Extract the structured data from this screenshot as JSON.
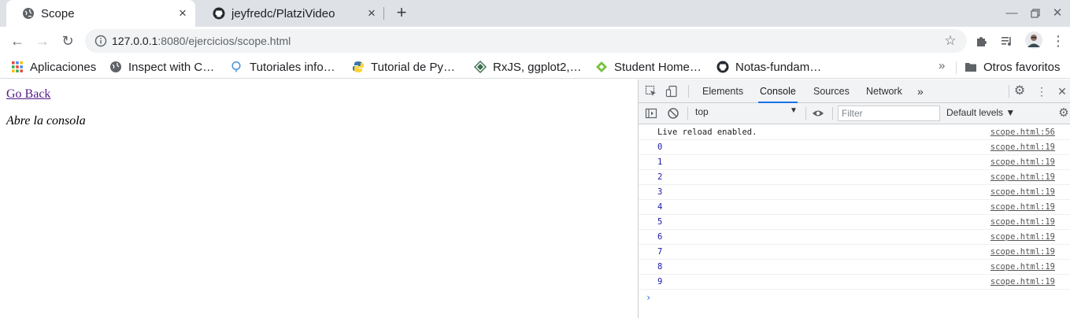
{
  "browser": {
    "tabs": [
      {
        "title": "Scope",
        "icon": "globe-icon",
        "active": true
      },
      {
        "title": "jeyfredc/PlatziVideo",
        "icon": "github-icon",
        "active": false
      }
    ],
    "new_tab": "+",
    "close_glyph": "×",
    "url": {
      "host": "127.0.0.1",
      "rest": ":8080/ejercicios/scope.html"
    },
    "bookmarks": [
      {
        "label": "Aplicaciones",
        "icon": "apps-grid-icon"
      },
      {
        "label": "Inspect with C…",
        "icon": "globe-icon"
      },
      {
        "label": "Tutoriales info…",
        "icon": "search-bulb-icon"
      },
      {
        "label": "Tutorial de Py…",
        "icon": "python-icon"
      },
      {
        "label": "RxJS, ggplot2,…",
        "icon": "diamond-icon"
      },
      {
        "label": "Student Home…",
        "icon": "green-diamond-icon"
      },
      {
        "label": "Notas-fundam…",
        "icon": "github-icon"
      }
    ],
    "bookmarks_overflow": "»",
    "other_bookmarks": "Otros favoritos"
  },
  "page": {
    "back_link": "Go Back",
    "instruction": "Abre la consola"
  },
  "devtools": {
    "tabs": [
      "Elements",
      "Console",
      "Sources",
      "Network"
    ],
    "active_tab": "Console",
    "more_tabs": "»",
    "context": "top",
    "filter_placeholder": "Filter",
    "levels": "Default levels ▼",
    "logs": [
      {
        "msg": "Live reload enabled.",
        "src": "scope.html:56",
        "kind": "text"
      },
      {
        "msg": "0",
        "src": "scope.html:19",
        "kind": "num"
      },
      {
        "msg": "1",
        "src": "scope.html:19",
        "kind": "num"
      },
      {
        "msg": "2",
        "src": "scope.html:19",
        "kind": "num"
      },
      {
        "msg": "3",
        "src": "scope.html:19",
        "kind": "num"
      },
      {
        "msg": "4",
        "src": "scope.html:19",
        "kind": "num"
      },
      {
        "msg": "5",
        "src": "scope.html:19",
        "kind": "num"
      },
      {
        "msg": "6",
        "src": "scope.html:19",
        "kind": "num"
      },
      {
        "msg": "7",
        "src": "scope.html:19",
        "kind": "num"
      },
      {
        "msg": "8",
        "src": "scope.html:19",
        "kind": "num"
      },
      {
        "msg": "9",
        "src": "scope.html:19",
        "kind": "num"
      }
    ],
    "prompt": "›"
  },
  "colors": {
    "accent": "#1a73e8",
    "link_visited": "#551a8b",
    "log_number": "#1a1aa6"
  }
}
